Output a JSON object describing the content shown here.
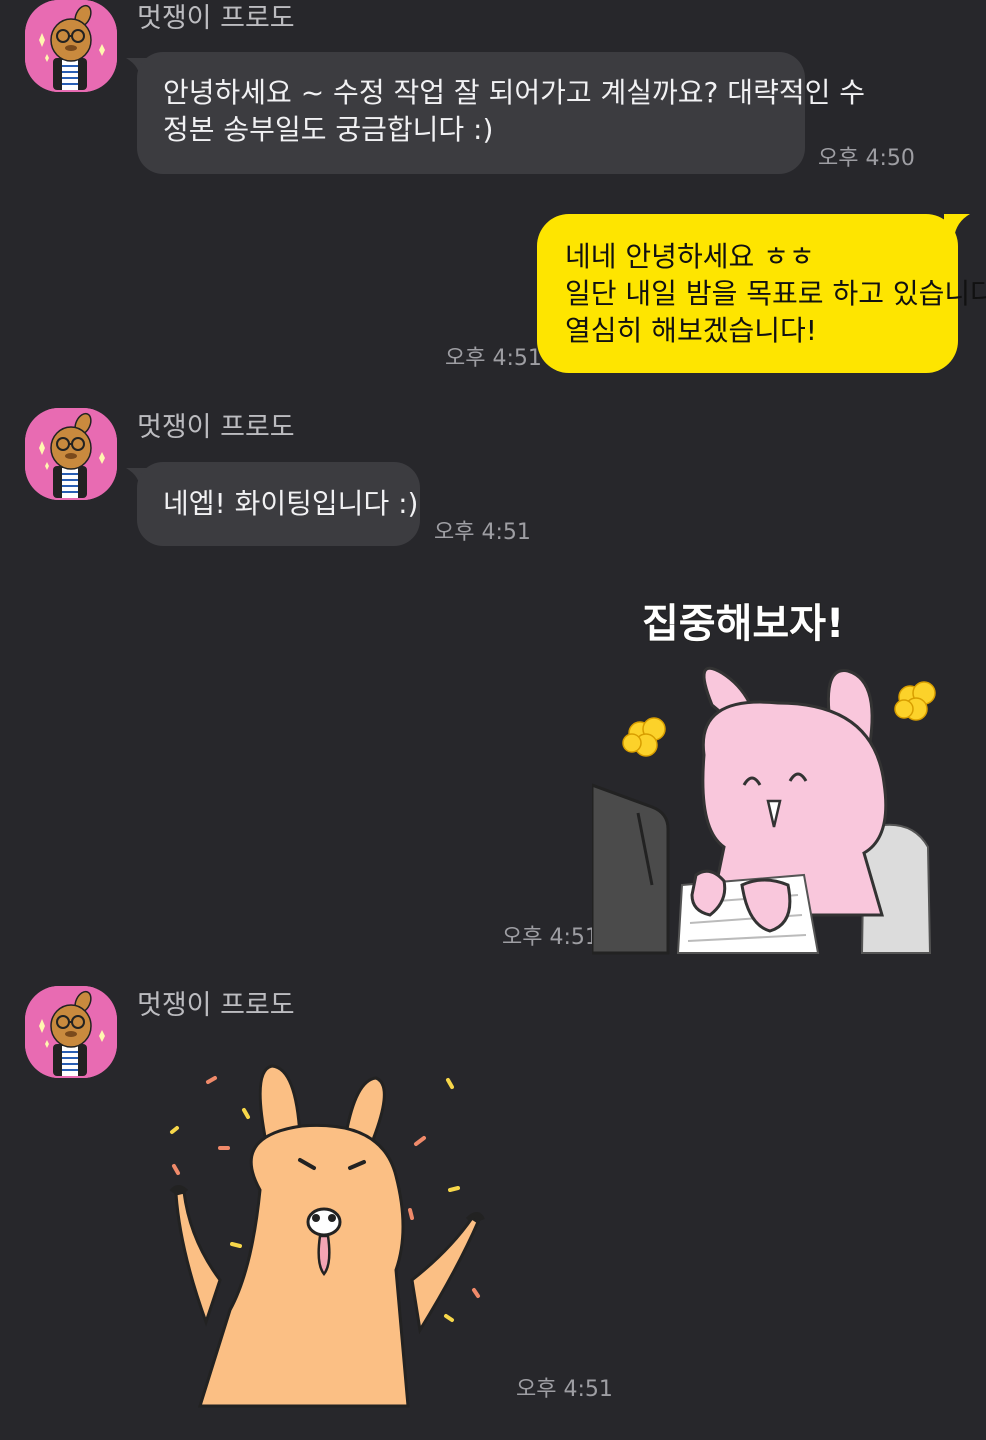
{
  "chat": {
    "contact_name": "멋쟁이 프로도",
    "messages": [
      {
        "sender": "멋쟁이 프로도",
        "lines": [
          "안녕하세요 ~ 수정 작업 잘 되어가고 계실까요? 대략적인 수",
          "정본 송부일도 궁금합니다 :)"
        ],
        "time": "오후 4:50"
      },
      {
        "sender": "me",
        "lines": [
          "네네 안녕하세요 ㅎㅎ",
          "일단 내일 밤을 목표로 하고 있습니다!",
          "열심히 해보겠습니다!"
        ],
        "time": "오후 4:51"
      },
      {
        "sender": "멋쟁이 프로도",
        "lines": [
          "네엡! 화이팅입니다 :)"
        ],
        "time": "오후 4:51"
      },
      {
        "sender": "me",
        "sticker": "pink-bunny-typing-sticker",
        "sticker_caption": "집중해보자!",
        "time": "오후 4:51"
      },
      {
        "sender": "멋쟁이 프로도",
        "sticker": "frodo-cheering-sticker",
        "time": "오후 4:51"
      }
    ]
  },
  "colors": {
    "background": "#27272b",
    "incoming_bubble": "#3c3c40",
    "outgoing_bubble": "#fee500",
    "avatar_background": "#e86bb2",
    "timestamp": "#9e9ea3"
  }
}
